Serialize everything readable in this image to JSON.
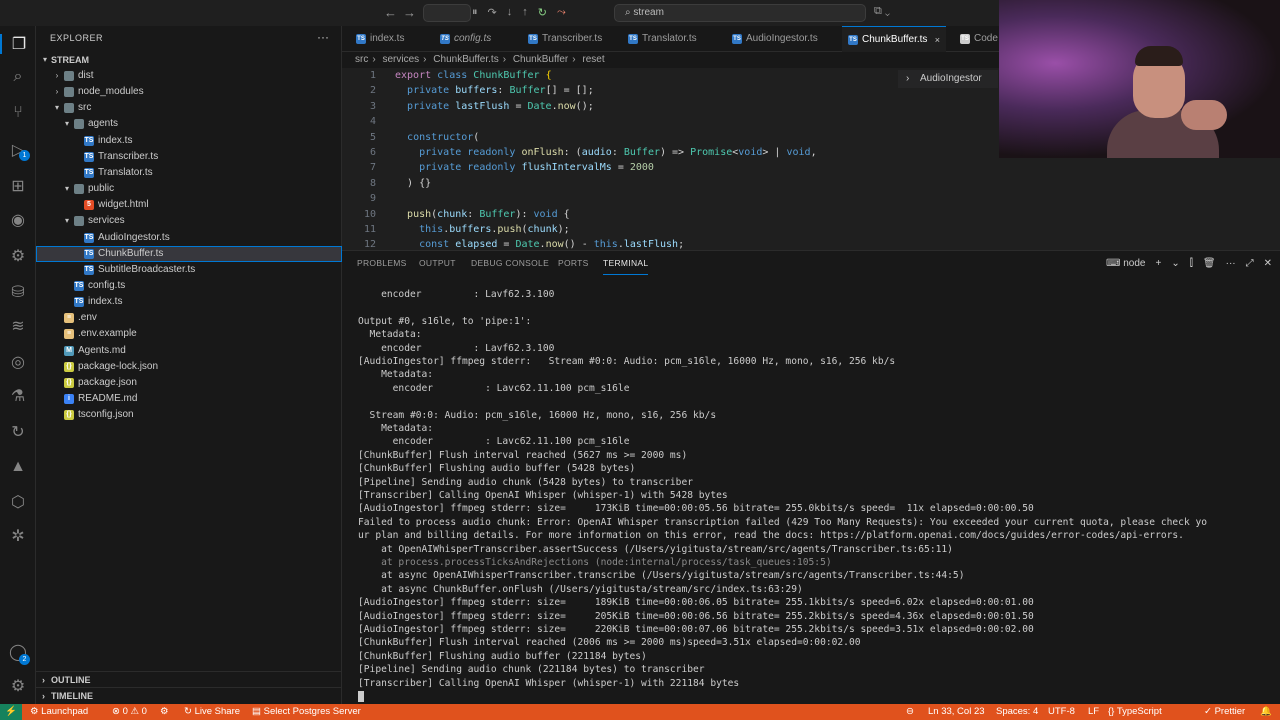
{
  "titlebar": {
    "back_icon": "←",
    "forward_icon": "→",
    "search_text": "stream",
    "debug_icons": [
      "⏸",
      "↷",
      "↓",
      "↑",
      "↻",
      "⤳"
    ]
  },
  "activity": {
    "icons": [
      "files-icon",
      "search-icon",
      "source-control-icon",
      "run-debug-icon",
      "extensions-icon",
      "remote-icon",
      "database-icon",
      "docker-icon",
      "testing-icon",
      "github-icon",
      "timeline-icon",
      "liveshare-icon",
      "azure-icon",
      "postman-icon",
      "copilot-icon"
    ],
    "debug_badge": "1",
    "account_badge": "2"
  },
  "sidebar": {
    "title": "EXPLORER",
    "more": "···",
    "root": "STREAM",
    "items": [
      {
        "label": "dist",
        "type": "folder",
        "depth": 1,
        "open": false
      },
      {
        "label": "node_modules",
        "type": "folder",
        "depth": 1,
        "open": false
      },
      {
        "label": "src",
        "type": "folder",
        "depth": 1,
        "open": true
      },
      {
        "label": "agents",
        "type": "folder",
        "depth": 2,
        "open": true
      },
      {
        "label": "index.ts",
        "type": "ts",
        "depth": 3
      },
      {
        "label": "Transcriber.ts",
        "type": "ts",
        "depth": 3
      },
      {
        "label": "Translator.ts",
        "type": "ts",
        "depth": 3
      },
      {
        "label": "public",
        "type": "folder",
        "depth": 2,
        "open": true
      },
      {
        "label": "widget.html",
        "type": "html",
        "depth": 3
      },
      {
        "label": "services",
        "type": "folder",
        "depth": 2,
        "open": true
      },
      {
        "label": "AudioIngestor.ts",
        "type": "ts",
        "depth": 3
      },
      {
        "label": "ChunkBuffer.ts",
        "type": "ts",
        "depth": 3,
        "selected": true
      },
      {
        "label": "SubtitleBroadcaster.ts",
        "type": "ts",
        "depth": 3
      },
      {
        "label": "config.ts",
        "type": "ts",
        "depth": 2
      },
      {
        "label": "index.ts",
        "type": "ts",
        "depth": 2
      },
      {
        "label": ".env",
        "type": "env",
        "depth": 1
      },
      {
        "label": ".env.example",
        "type": "env",
        "depth": 1
      },
      {
        "label": "Agents.md",
        "type": "md",
        "depth": 1
      },
      {
        "label": "package-lock.json",
        "type": "json",
        "depth": 1
      },
      {
        "label": "package.json",
        "type": "json",
        "depth": 1
      },
      {
        "label": "README.md",
        "type": "info",
        "depth": 1
      },
      {
        "label": "tsconfig.json",
        "type": "json",
        "depth": 1
      }
    ],
    "outline": "OUTLINE",
    "timeline": "TIMELINE"
  },
  "tabs": [
    {
      "label": "index.ts",
      "italic": false
    },
    {
      "label": "config.ts",
      "italic": true
    },
    {
      "label": "Transcriber.ts",
      "italic": false
    },
    {
      "label": "Translator.ts",
      "italic": false
    },
    {
      "label": "AudioIngestor.ts",
      "italic": false
    },
    {
      "label": "ChunkBuffer.ts",
      "italic": false,
      "active": true,
      "close": "×"
    },
    {
      "label": "Code",
      "italic": false
    }
  ],
  "breadcrumb": [
    "src",
    "services",
    "ChunkBuffer.ts",
    "ChunkBuffer",
    "reset"
  ],
  "sticky_outline": "AudioIngestor",
  "code": [
    {
      "n": "1",
      "html": "<span class='kw'>export</span> <span class='kw2'>class</span> <span class='ty'>ChunkBuffer</span> <span class='pn'>{</span>"
    },
    {
      "n": "2",
      "html": "  <span class='kw2'>private</span> <span class='vr'>buffers</span>: <span class='ty'>Buffer</span>[] = [];"
    },
    {
      "n": "3",
      "html": "  <span class='kw2'>private</span> <span class='vr'>lastFlush</span> = <span class='ty'>Date</span>.<span class='fn'>now</span>();"
    },
    {
      "n": "4",
      "html": ""
    },
    {
      "n": "5",
      "html": "  <span class='kw2'>constructor</span>("
    },
    {
      "n": "6",
      "html": "    <span class='kw2'>private</span> <span class='kw2'>readonly</span> <span class='fn'>onFlush</span>: (<span class='vr'>audio</span>: <span class='ty'>Buffer</span>) => <span class='ty'>Promise</span>&lt;<span class='kw2'>void</span>&gt; | <span class='kw2'>void</span>,"
    },
    {
      "n": "7",
      "html": "    <span class='kw2'>private</span> <span class='kw2'>readonly</span> <span class='vr'>flushIntervalMs</span> = <span class='nm'>2000</span>"
    },
    {
      "n": "8",
      "html": "  ) {}"
    },
    {
      "n": "9",
      "html": ""
    },
    {
      "n": "10",
      "html": "  <span class='fn'>push</span>(<span class='vr'>chunk</span>: <span class='ty'>Buffer</span>): <span class='kw2'>void</span> {"
    },
    {
      "n": "11",
      "html": "    <span class='kw2'>this</span>.<span class='vr'>buffers</span>.<span class='fn'>push</span>(<span class='vr'>chunk</span>);"
    },
    {
      "n": "12",
      "html": "    <span class='kw2'>const</span> <span class='vr'>elapsed</span> = <span class='ty'>Date</span>.<span class='fn'>now</span>() - <span class='kw2'>this</span>.<span class='vr'>lastFlush</span>;"
    }
  ],
  "panel": {
    "tabs": [
      "PROBLEMS",
      "OUTPUT",
      "DEBUG CONSOLE",
      "PORTS",
      "TERMINAL"
    ],
    "active_tab": "TERMINAL",
    "terminal_name": "node",
    "controls": [
      "+",
      "⌄",
      "⫿",
      "🗑",
      "···",
      "⤢",
      "✕"
    ]
  },
  "terminal_lines": [
    {
      "t": "    encoder         : Lavf62.3.100",
      "dim": false
    },
    {
      "t": "",
      "dim": false
    },
    {
      "t": "Output #0, s16le, to 'pipe:1':",
      "dim": false
    },
    {
      "t": "  Metadata:",
      "dim": false
    },
    {
      "t": "    encoder         : Lavf62.3.100",
      "dim": false
    },
    {
      "t": "[AudioIngestor] ffmpeg stderr:   Stream #0:0: Audio: pcm_s16le, 16000 Hz, mono, s16, 256 kb/s",
      "dim": false
    },
    {
      "t": "    Metadata:",
      "dim": false
    },
    {
      "t": "      encoder         : Lavc62.11.100 pcm_s16le",
      "dim": false
    },
    {
      "t": "",
      "dim": false
    },
    {
      "t": "  Stream #0:0: Audio: pcm_s16le, 16000 Hz, mono, s16, 256 kb/s",
      "dim": false
    },
    {
      "t": "    Metadata:",
      "dim": false
    },
    {
      "t": "      encoder         : Lavc62.11.100 pcm_s16le",
      "dim": false
    },
    {
      "t": "[ChunkBuffer] Flush interval reached (5627 ms >= 2000 ms)",
      "dim": false
    },
    {
      "t": "[ChunkBuffer] Flushing audio buffer (5428 bytes)",
      "dim": false
    },
    {
      "t": "[Pipeline] Sending audio chunk (5428 bytes) to transcriber",
      "dim": false
    },
    {
      "t": "[Transcriber] Calling OpenAI Whisper (whisper-1) with 5428 bytes",
      "dim": false
    },
    {
      "t": "[AudioIngestor] ffmpeg stderr: size=     173KiB time=00:00:05.56 bitrate= 255.0kbits/s speed=  11x elapsed=0:00:00.50",
      "dim": false
    },
    {
      "t": "Failed to process audio chunk: Error: OpenAI Whisper transcription failed (429 Too Many Requests): You exceeded your current quota, please check yo",
      "dim": false
    },
    {
      "t": "ur plan and billing details. For more information on this error, read the docs: https://platform.openai.com/docs/guides/error-codes/api-errors.",
      "dim": false
    },
    {
      "t": "    at OpenAIWhisperTranscriber.assertSuccess (/Users/yigitusta/stream/src/agents/Transcriber.ts:65:11)",
      "dim": false
    },
    {
      "t": "    at process.processTicksAndRejections (node:internal/process/task_queues:105:5)",
      "dim": true
    },
    {
      "t": "    at async OpenAIWhisperTranscriber.transcribe (/Users/yigitusta/stream/src/agents/Transcriber.ts:44:5)",
      "dim": false
    },
    {
      "t": "    at async ChunkBuffer.onFlush (/Users/yigitusta/stream/src/index.ts:63:29)",
      "dim": false
    },
    {
      "t": "[AudioIngestor] ffmpeg stderr: size=     189KiB time=00:00:06.05 bitrate= 255.1kbits/s speed=6.02x elapsed=0:00:01.00",
      "dim": false
    },
    {
      "t": "[AudioIngestor] ffmpeg stderr: size=     205KiB time=00:00:06.56 bitrate= 255.2kbits/s speed=4.36x elapsed=0:00:01.50",
      "dim": false
    },
    {
      "t": "[AudioIngestor] ffmpeg stderr: size=     220KiB time=00:00:07.06 bitrate= 255.2kbits/s speed=3.51x elapsed=0:00:02.00",
      "dim": false
    },
    {
      "t": "[ChunkBuffer] Flush interval reached (2006 ms >= 2000 ms)speed=3.51x elapsed=0:00:02.00",
      "dim": false
    },
    {
      "t": "[ChunkBuffer] Flushing audio buffer (221184 bytes)",
      "dim": false
    },
    {
      "t": "[Pipeline] Sending audio chunk (221184 bytes) to transcriber",
      "dim": false
    },
    {
      "t": "[Transcriber] Calling OpenAI Whisper (whisper-1) with 221184 bytes",
      "dim": false
    }
  ],
  "statusbar": {
    "remote": "⚡",
    "launchpad": "Launchpad",
    "problems": "⊗ 0 ⚠ 0",
    "tools": "⚙",
    "liveshare": "Live Share",
    "postgres": "Select Postgres Server",
    "position": "Ln 33, Col 23",
    "spaces": "Spaces: 4",
    "encoding": "UTF-8",
    "eol": "LF",
    "language": "TypeScript",
    "prettier": "✓ Prettier",
    "bell": "🔔"
  },
  "colors": {
    "statusbar": "#e0521d",
    "accent": "#0078d4",
    "ts_icon": "#3178c6"
  }
}
